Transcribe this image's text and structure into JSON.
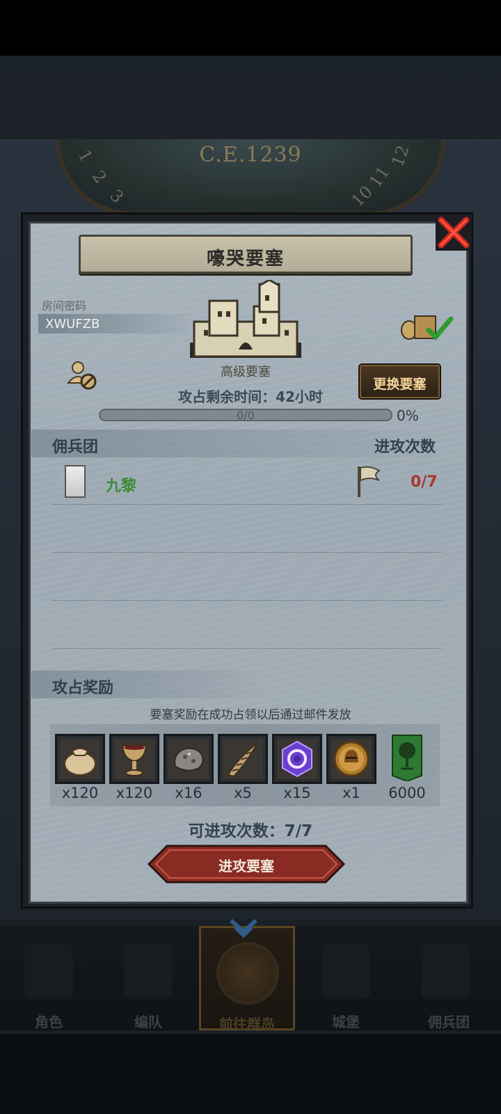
{
  "header": {
    "era": "C.E.1239",
    "dial_numbers": [
      "12",
      "11",
      "10",
      "1",
      "2",
      "3"
    ]
  },
  "dialog": {
    "title": "嚎哭要塞",
    "room_code_label": "房间密码",
    "room_code": "XWUFZB",
    "fortress_level": "高级要塞",
    "remaining_time": "攻占剩余时间：42小时",
    "progress": {
      "text": "0/0",
      "percent_label": "0%",
      "value": 0
    },
    "change_button": "更换要塞",
    "mercenary_header": "佣兵团",
    "attack_count_header": "进攻次数",
    "mercenaries": [
      {
        "name": "九黎",
        "attacks": "0/7"
      }
    ],
    "rewards_header": "攻占奖励",
    "rewards_note": "要塞奖励在成功占领以后通过邮件发放",
    "rewards": [
      {
        "icon": "sack-icon",
        "qty": "x120"
      },
      {
        "icon": "goblet-icon",
        "qty": "x120"
      },
      {
        "icon": "ore-icon",
        "qty": "x16"
      },
      {
        "icon": "horn-icon",
        "qty": "x5"
      },
      {
        "icon": "purple-gem-icon",
        "qty": "x15"
      },
      {
        "icon": "helmet-medal-icon",
        "qty": "x1"
      },
      {
        "icon": "tree-banner-icon",
        "qty": "6000"
      }
    ],
    "attacks_available": "可进攻次数：7/7",
    "attack_button": "进攻要塞"
  },
  "nav": [
    {
      "label": "角色"
    },
    {
      "label": "编队"
    },
    {
      "label": "前往群岛",
      "active": true
    },
    {
      "label": "城堡"
    },
    {
      "label": "佣兵团"
    }
  ],
  "colors": {
    "accent_gold": "#c2a24d",
    "merc_green": "#3d8a35",
    "count_red": "#a8362f"
  }
}
